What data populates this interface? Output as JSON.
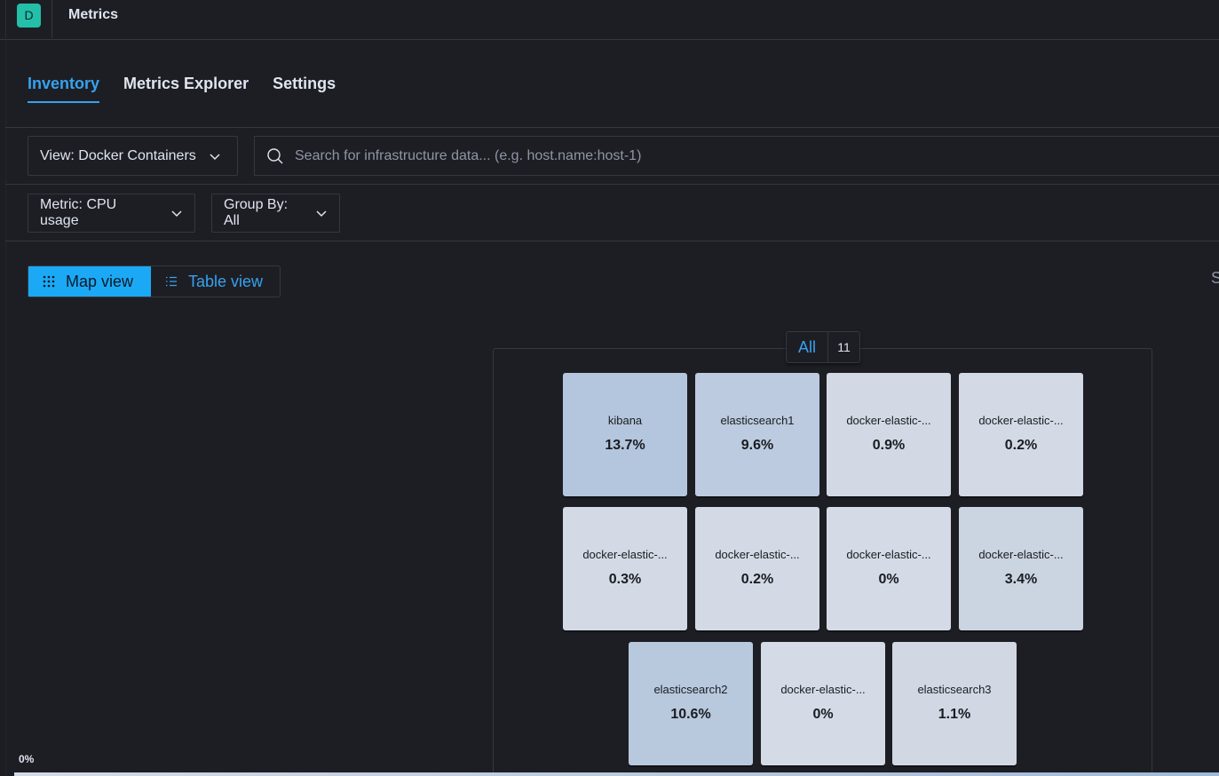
{
  "header": {
    "avatar_letter": "D",
    "app_title": "Metrics"
  },
  "tabs": [
    {
      "label": "Inventory",
      "active": true
    },
    {
      "label": "Metrics Explorer",
      "active": false
    },
    {
      "label": "Settings",
      "active": false
    }
  ],
  "toolbar": {
    "view_label": "View: Docker Containers",
    "search_placeholder": "Search for infrastructure data... (e.g. host.name:host-1)",
    "search_value": "",
    "metric_label": "Metric: CPU usage",
    "group_by_label": "Group By: All",
    "map_view_label": "Map view",
    "table_view_label": "Table view",
    "edge_text": "S"
  },
  "map": {
    "group_name": "All",
    "group_count": "11",
    "nodes": [
      {
        "name": "kibana",
        "value": "13.7%",
        "color": "#b4c6dd"
      },
      {
        "name": "elasticsearch1",
        "value": "9.6%",
        "color": "#bccbdf"
      },
      {
        "name": "docker-elastic-...",
        "value": "0.9%",
        "color": "#d2d9e4"
      },
      {
        "name": "docker-elastic-...",
        "value": "0.2%",
        "color": "#d4dae5"
      },
      {
        "name": "docker-elastic-...",
        "value": "0.3%",
        "color": "#d3dae5"
      },
      {
        "name": "docker-elastic-...",
        "value": "0.2%",
        "color": "#d4dae5"
      },
      {
        "name": "docker-elastic-...",
        "value": "0%",
        "color": "#d4dbe6"
      },
      {
        "name": "docker-elastic-...",
        "value": "3.4%",
        "color": "#cbd4e1"
      },
      {
        "name": "elasticsearch2",
        "value": "10.6%",
        "color": "#b8c9de"
      },
      {
        "name": "docker-elastic-...",
        "value": "0%",
        "color": "#d4dbe6"
      },
      {
        "name": "elasticsearch3",
        "value": "1.1%",
        "color": "#d1d8e4"
      }
    ]
  },
  "legend": {
    "min_label": "0%"
  },
  "colors": {
    "accent": "#36a2ef",
    "background": "#1d1e24",
    "border": "#343741"
  }
}
